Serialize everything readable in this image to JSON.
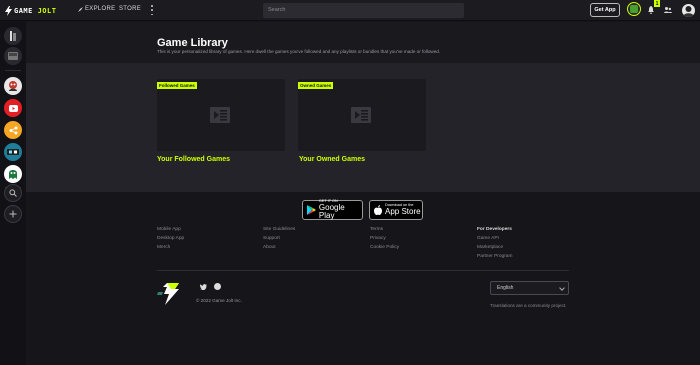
{
  "topbar": {
    "logo_text_a": "GAME",
    "logo_text_b": "JOLT",
    "explore_label": "EXPLORE",
    "store_label": "STORE",
    "search_placeholder": "Search",
    "get_app_label": "Get App",
    "notification_count": "1"
  },
  "page": {
    "title": "Game Library",
    "subtitle": "This is your personalized library of games. Here dwell the games you've followed and any playlists or bundles that you've made or followed."
  },
  "cards": [
    {
      "tag": "Followed Games",
      "label": "Your Followed Games"
    },
    {
      "tag": "Owned Games",
      "label": "Owned Games"
    }
  ],
  "card_labels": [
    "Your Followed Games",
    "Your Owned Games"
  ],
  "store_buttons": {
    "google": {
      "small": "GET IT ON",
      "big": "Google Play"
    },
    "apple": {
      "small": "Download on the",
      "big": "App Store"
    }
  },
  "footer": {
    "col1": [
      "Mobile App",
      "Desktop App",
      "Merch"
    ],
    "col2": [
      "Site Guidelines",
      "Support",
      "About"
    ],
    "col3": [
      "Terms",
      "Privacy",
      "Cookie Policy"
    ],
    "col4_head": "For Developers",
    "col4": [
      "Game API",
      "Marketplace",
      "Partner Program"
    ],
    "copyright": "© 2022 Game Jolt Inc.",
    "language": "English",
    "translation_note": "Translations are a community project."
  },
  "colors": {
    "accent": "#ccff00",
    "background": "#161519",
    "band": "#24232a"
  },
  "icons": {
    "sidebar": [
      "library-icon",
      "inbox-icon",
      "avatar-community",
      "youtube-icon",
      "share-icon",
      "game-community-icon",
      "ghost-community-icon",
      "search-icon",
      "add-icon"
    ]
  }
}
